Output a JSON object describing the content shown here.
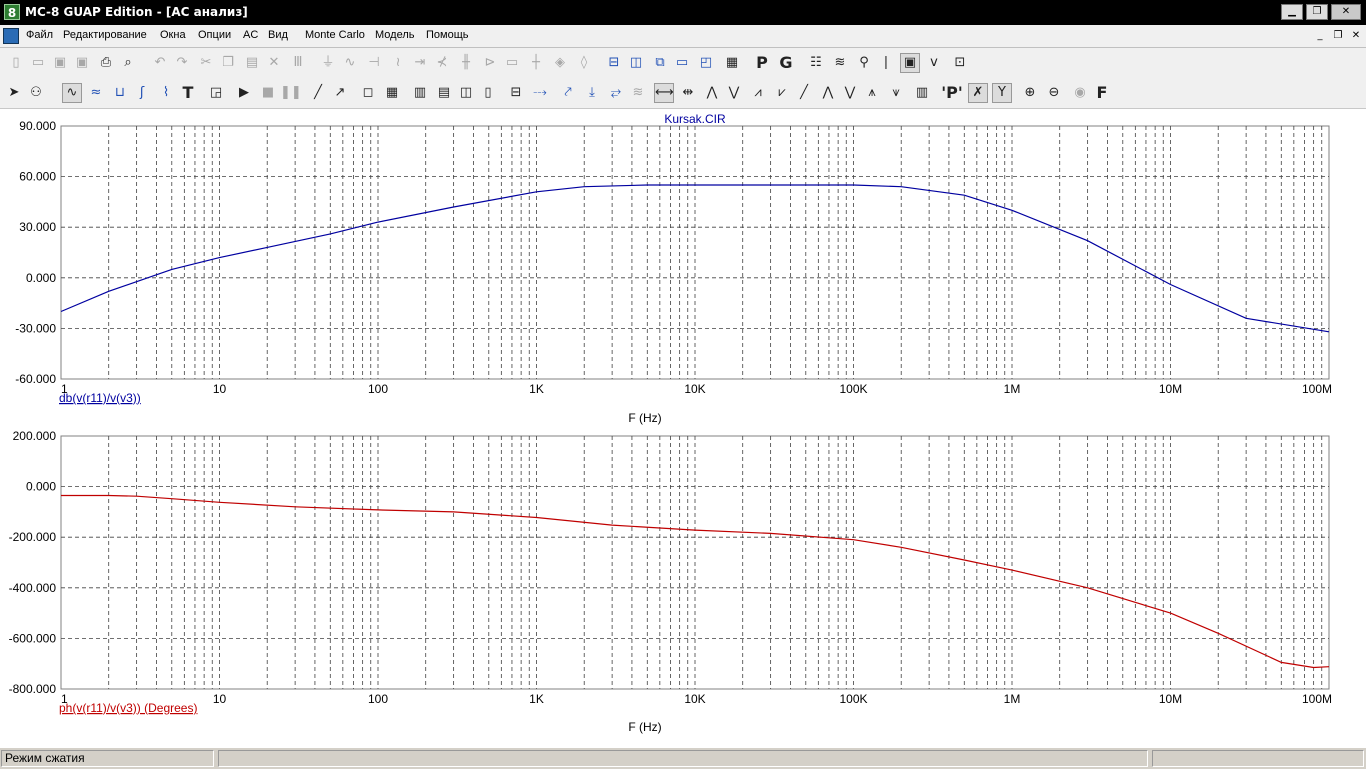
{
  "window": {
    "app_icon": "8",
    "title": "MC-8 GUAP Edition - [AC анализ]"
  },
  "menu": {
    "items": [
      "Файл",
      "Редактирование",
      "Окна",
      "Опции",
      "AC",
      "Вид",
      "Monte Carlo",
      "Модель",
      "Помощь"
    ]
  },
  "toolbar1": {
    "icons": [
      "new-file-icon",
      "open-file-icon",
      "save-icon",
      "save-as-icon",
      "print-icon",
      "print-preview-icon",
      "undo-icon",
      "redo-icon",
      "cut-icon",
      "copy-icon",
      "paste-icon",
      "delete-icon",
      "select-all-icon",
      "ground-icon",
      "resistor-icon",
      "capacitor-icon",
      "inductor-icon",
      "diode-icon",
      "transistor-icon",
      "battery-icon",
      "source-icon",
      "nand-icon",
      "wire-icon",
      "junction-icon",
      "node-icon",
      "grid-icon",
      "split-horizontal-icon",
      "split-vertical-icon",
      "cascade-icon",
      "window-icon",
      "tile-icon",
      "calculator-icon",
      "p-icon",
      "g-icon",
      "analysis-icon",
      "waveform-icon",
      "probe-icon",
      "pin-icon",
      "screenshot-icon",
      "axis-icon",
      "zoom-window-icon"
    ],
    "letters": [
      "P",
      "G"
    ]
  },
  "toolbar2": {
    "icons": [
      "pointer-icon",
      "select-mode-icon",
      "scope-icon",
      "wave-icon",
      "cursor-icon",
      "measure-icon",
      "graph-icon",
      "text-icon",
      "properties-icon",
      "run-icon",
      "stop-icon",
      "pause-icon",
      "line-icon",
      "arrow-line-icon",
      "box-icon",
      "grid-icon",
      "format-1-icon",
      "format-2-icon",
      "format-3-icon",
      "format-4-icon",
      "axis-box-icon",
      "trend-icon",
      "peak-icon",
      "valley-icon",
      "high-icon",
      "cursor-left-icon",
      "cursor-right-icon",
      "next-peak-icon",
      "next-valley-icon",
      "peak-2-icon",
      "valley-2-icon",
      "slope-icon",
      "max-icon",
      "min-icon",
      "max-2-icon",
      "min-2-icon",
      "table-icon",
      "label-icon",
      "x-axis-icon",
      "y-axis-icon",
      "zoom-in-icon",
      "zoom-out-icon",
      "color-icon",
      "font-icon"
    ],
    "letters": [
      "T",
      "'P'",
      "F"
    ]
  },
  "chart_data": [
    {
      "type": "line",
      "title": "Kursak.CIR",
      "x_scale": "log",
      "xlim": [
        1,
        100000000
      ],
      "x_tick_labels": [
        "1",
        "10",
        "100",
        "1K",
        "10K",
        "100K",
        "1M",
        "10M",
        "100M"
      ],
      "xlabel": "F (Hz)",
      "ylim": [
        -60,
        90
      ],
      "y_tick_labels": [
        "90.000",
        "60.000",
        "30.000",
        "0.000",
        "-30.000",
        "-60.000"
      ],
      "grid": true,
      "series": [
        {
          "name": "db(v(r11)/v(v3))",
          "color": "#0000a0",
          "x": [
            1,
            2,
            5,
            10,
            20,
            50,
            100,
            300,
            1000,
            2000,
            5000,
            10000,
            100000,
            200000,
            500000,
            1000000,
            3000000,
            10000000,
            30000000,
            100000000
          ],
          "y": [
            -20,
            -8,
            5,
            12,
            18,
            26,
            33,
            42,
            51,
            54,
            55,
            55,
            55,
            54,
            49,
            40,
            22,
            -4,
            -24,
            -32
          ]
        }
      ]
    },
    {
      "type": "line",
      "title": "",
      "x_scale": "log",
      "xlim": [
        1,
        100000000
      ],
      "x_tick_labels": [
        "1",
        "10",
        "100",
        "1K",
        "10K",
        "100K",
        "1M",
        "10M",
        "100M"
      ],
      "xlabel": "F (Hz)",
      "ylim": [
        -800,
        200
      ],
      "y_tick_labels": [
        "200.000",
        "0.000",
        "-200.000",
        "-400.000",
        "-600.000",
        "-800.000"
      ],
      "grid": true,
      "series": [
        {
          "name": "ph(v(r11)/v(v3)) (Degrees)",
          "color": "#c00000",
          "x": [
            1,
            2,
            3,
            5,
            10,
            30,
            100,
            300,
            1000,
            3000,
            10000,
            30000,
            100000,
            200000,
            500000,
            1000000,
            3000000,
            10000000,
            20000000,
            50000000,
            80000000,
            100000000
          ],
          "y": [
            -35,
            -35,
            -38,
            -48,
            -62,
            -80,
            -92,
            -100,
            -122,
            -152,
            -172,
            -185,
            -210,
            -240,
            -290,
            -330,
            -400,
            -500,
            -580,
            -695,
            -715,
            -712
          ]
        }
      ]
    }
  ],
  "status": {
    "mode_text": "Режим сжатия",
    "panel2": "",
    "panel3": ""
  },
  "colors": {
    "grid": "#404040",
    "plot_bg": "#ffffff",
    "axis_text": "#000000",
    "title_text": "#0000a0"
  }
}
